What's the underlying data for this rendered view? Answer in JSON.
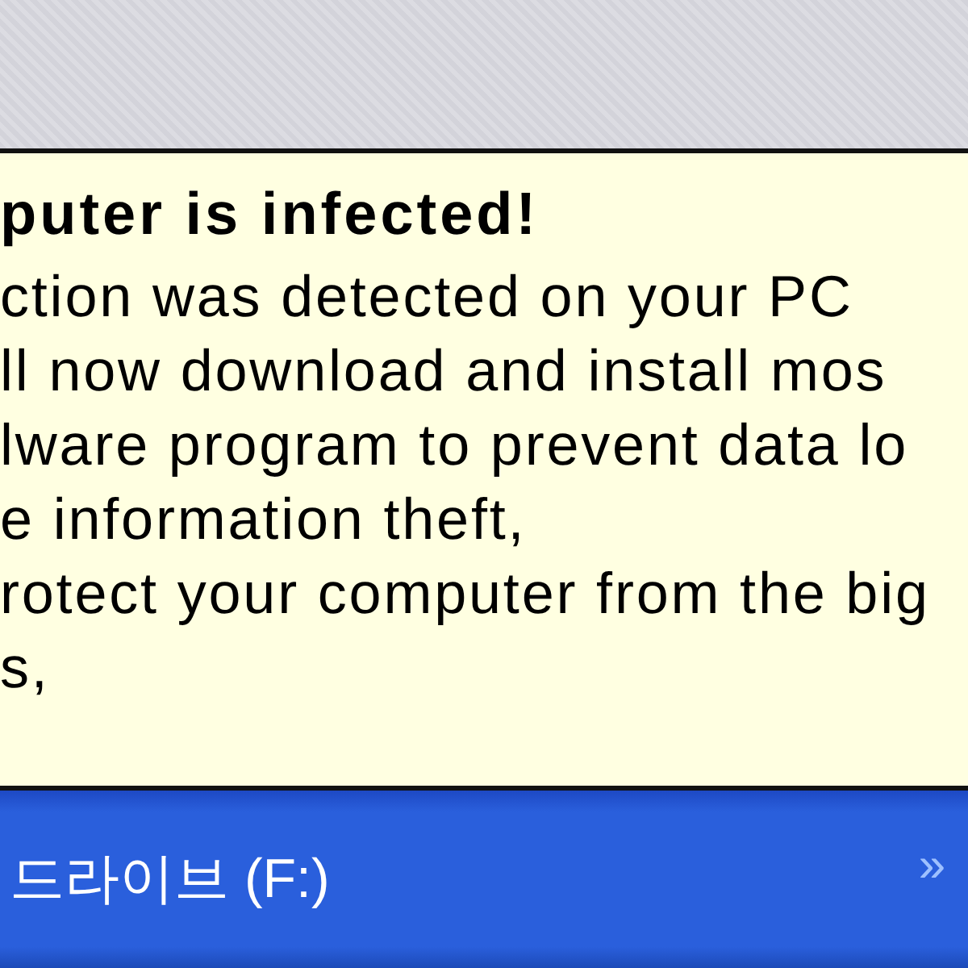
{
  "balloon": {
    "title": "puter is infected!",
    "lines": [
      "ction was detected on your PC",
      "ll now download and install mos",
      "lware program to prevent data lo",
      "e information theft,",
      "rotect your computer from the big",
      "s,"
    ]
  },
  "taskbar": {
    "label": "드라이브 (F:)",
    "chevron": "»"
  }
}
